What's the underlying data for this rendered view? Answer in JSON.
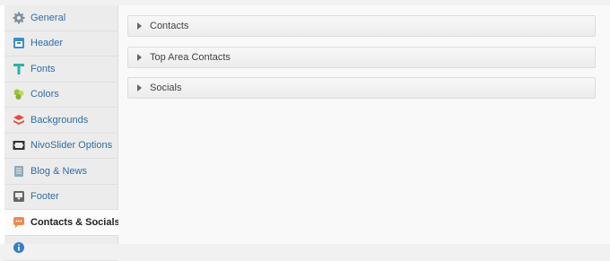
{
  "sidebar": {
    "items": [
      {
        "label": "General",
        "icon": "gear-icon"
      },
      {
        "label": "Header",
        "icon": "header-icon"
      },
      {
        "label": "Fonts",
        "icon": "font-icon"
      },
      {
        "label": "Colors",
        "icon": "palette-icon"
      },
      {
        "label": "Backgrounds",
        "icon": "layers-icon"
      },
      {
        "label": "NivoSlider Options",
        "icon": "slider-icon"
      },
      {
        "label": "Blog & News",
        "icon": "document-icon"
      },
      {
        "label": "Footer",
        "icon": "footer-icon"
      },
      {
        "label": "Contacts & Socials",
        "icon": "chat-icon",
        "active": true
      },
      {
        "label": "",
        "icon": "info-icon"
      }
    ]
  },
  "main": {
    "sections": [
      {
        "label": "Contacts"
      },
      {
        "label": "Top Area Contacts"
      },
      {
        "label": "Socials"
      }
    ]
  },
  "colors": {
    "link": "#2f6da3",
    "active_text": "#222222",
    "sidebar_bg": "#ececec"
  }
}
